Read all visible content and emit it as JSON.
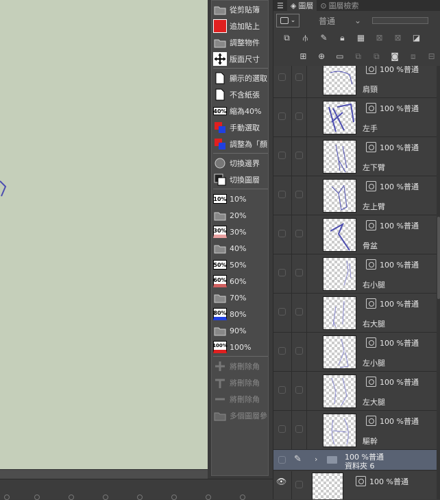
{
  "canvas": {
    "bg": "#c5cfba",
    "stroke_color": "#4c4db0"
  },
  "commands": [
    {
      "label": "從剪貼簿"
    },
    {
      "label": "追加貼上"
    },
    {
      "label": "調整物件"
    },
    {
      "label": "版面尺寸"
    },
    {
      "label": "顯示的選取"
    },
    {
      "label": "不含紙張"
    },
    {
      "label": "縮為40%",
      "icon_text": "40%"
    },
    {
      "label": "手動選取"
    },
    {
      "label": "調整為「顏"
    },
    {
      "label": "切換邊界"
    },
    {
      "label": "切換圖層"
    },
    {
      "label": "10%",
      "icon_text": "10%"
    },
    {
      "label": "20%"
    },
    {
      "label": "30%",
      "icon_text": "30%"
    },
    {
      "label": "40%"
    },
    {
      "label": "50%",
      "icon_text": "50%"
    },
    {
      "label": "60%",
      "icon_text": "60%"
    },
    {
      "label": "70%"
    },
    {
      "label": "80%",
      "icon_text": "80%"
    },
    {
      "label": "90%"
    },
    {
      "label": "100%",
      "icon_text": "100%"
    },
    {
      "label": "將刪除角"
    },
    {
      "label": "將刪除角"
    },
    {
      "label": "將刪除角"
    },
    {
      "label": "多個圖層參"
    }
  ],
  "panel": {
    "tabs": [
      {
        "label": "圖層"
      },
      {
        "label": "圖層檢索"
      }
    ],
    "blend_mode": "普通",
    "layer_mode_text": "100 %普通",
    "layers": [
      {
        "name": "肩頸"
      },
      {
        "name": "左手"
      },
      {
        "name": "左下臂"
      },
      {
        "name": "左上臂"
      },
      {
        "name": "骨盆"
      },
      {
        "name": "右小腿"
      },
      {
        "name": "右大腿"
      },
      {
        "name": "左小腿"
      },
      {
        "name": "左大腿"
      },
      {
        "name": "驅幹"
      }
    ],
    "folder": {
      "mode": "100 %普通",
      "name": "資料夾 6"
    },
    "last_layer": {
      "mode": "100 %普通"
    }
  }
}
